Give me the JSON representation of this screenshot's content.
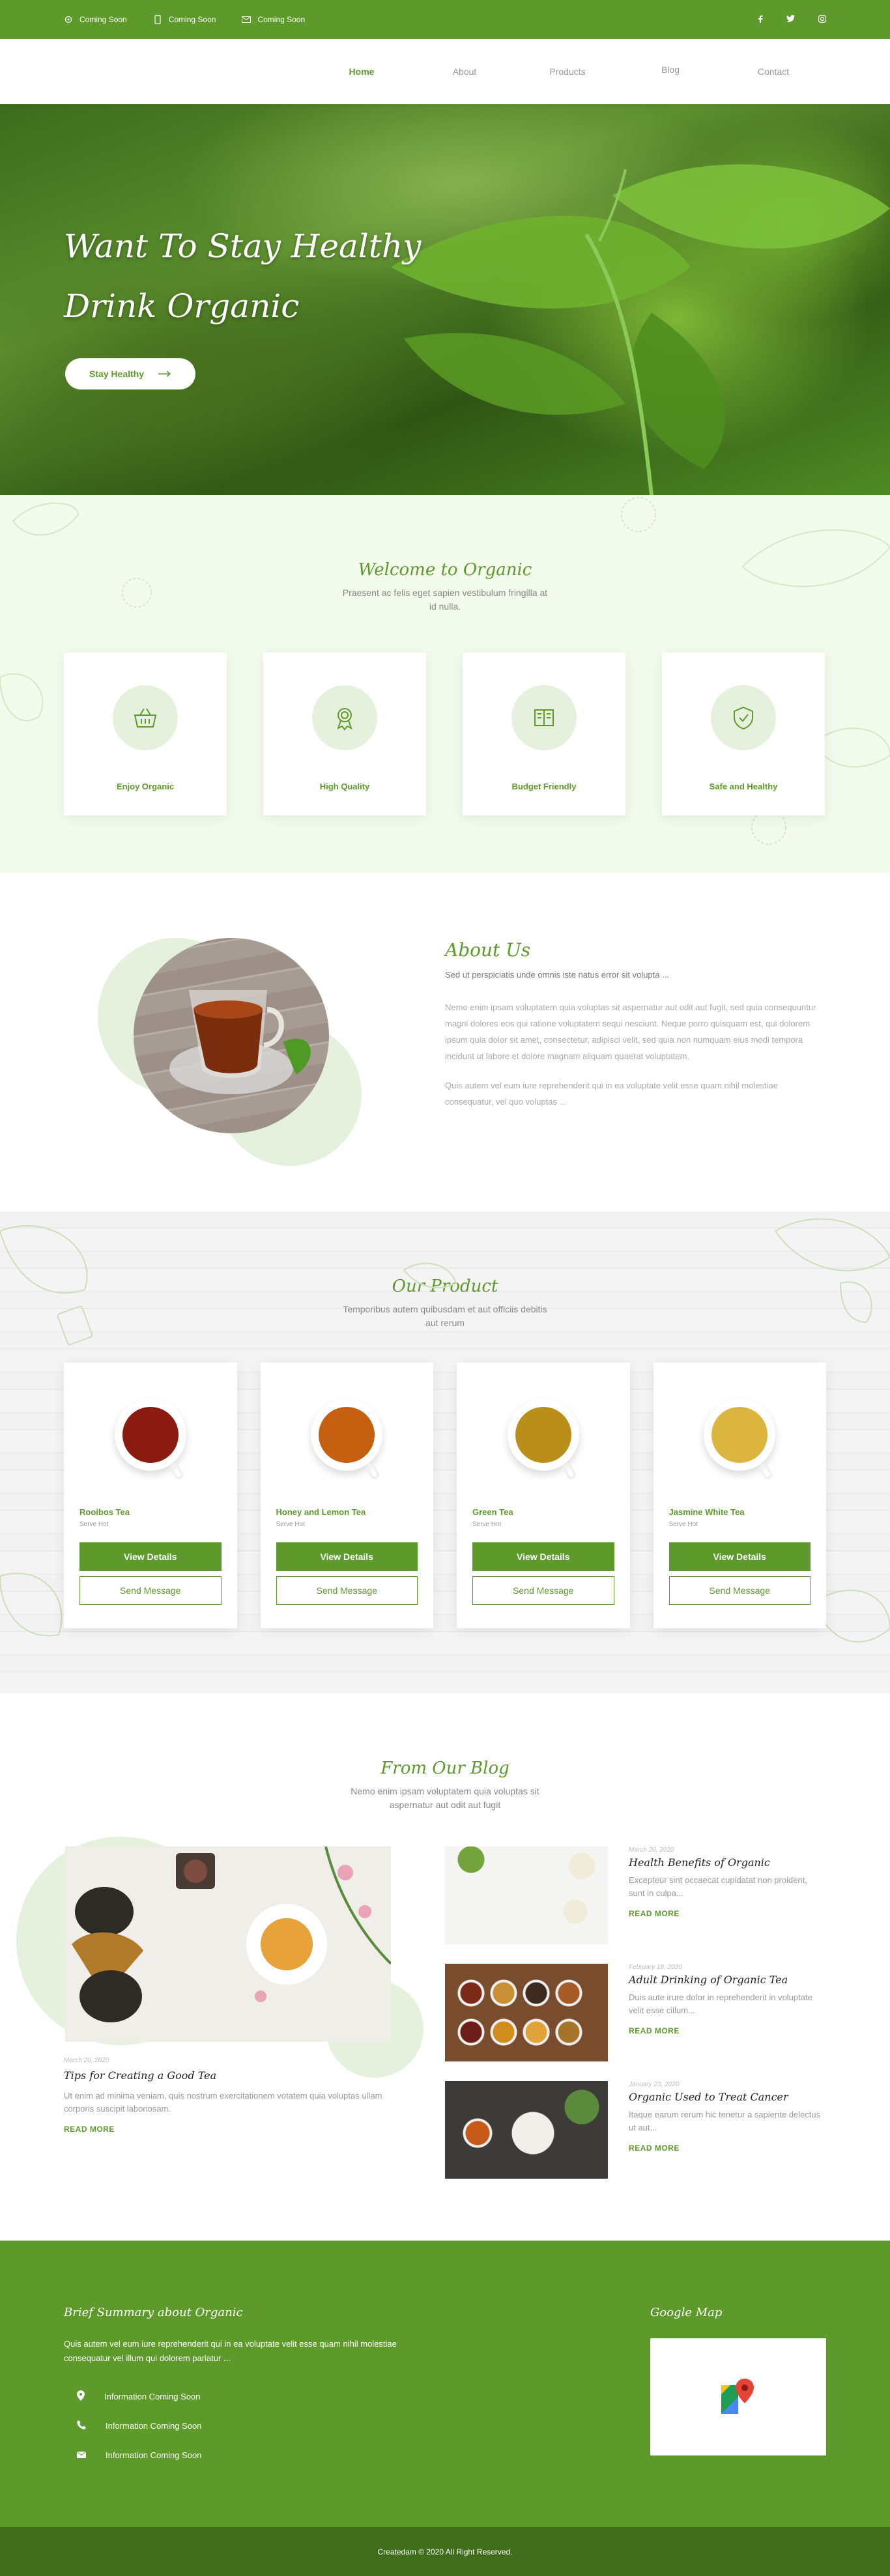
{
  "topbar": {
    "contacts": [
      {
        "icon": "location-icon",
        "text": "Coming Soon"
      },
      {
        "icon": "phone-icon",
        "text": "Coming Soon"
      },
      {
        "icon": "mail-icon",
        "text": "Coming Soon"
      }
    ],
    "socials": [
      "facebook-icon",
      "twitter-icon",
      "instagram-icon"
    ]
  },
  "nav": {
    "items": [
      "Home",
      "About",
      "Products",
      "Blog",
      "Contact"
    ],
    "active": "Home"
  },
  "hero": {
    "title_line1": "Want To Stay Healthy",
    "title_line2": "Drink Organic",
    "button_label": "Stay Healthy"
  },
  "welcome": {
    "title": "Welcome to Organic",
    "subtitle": "Praesent ac felis eget sapien vestibulum fringilla at id nulla.",
    "features": [
      {
        "icon": "basket-icon",
        "label": "Enjoy Organic"
      },
      {
        "icon": "award-badge-icon",
        "label": "High Quality"
      },
      {
        "icon": "money-icon",
        "label": "Budget Friendly"
      },
      {
        "icon": "shield-check-icon",
        "label": "Safe and Healthy"
      }
    ]
  },
  "about": {
    "title": "About Us",
    "lead": "Sed ut perspiciatis unde omnis iste natus error sit volupta ...",
    "paragraph1": "Nemo enim ipsam voluptatem quia voluptas sit aspernatur aut odit aut fugit, sed quia consequuntur magni dolores eos qui ratione voluptatem sequi nesciunt. Neque porro quisquam est, qui dolorem ipsum quia dolor sit amet, consectetur, adipisci velit, sed quia non numquam eius modi tempora incidunt ut labore et dolore magnam aliquam quaerat voluptatem.",
    "paragraph2": "Quis autem vel eum iure reprehenderit qui in ea voluptate velit esse quam nihil molestiae consequatur, vel quo voluptas ..."
  },
  "products": {
    "title": "Our Product",
    "subtitle": "Temporibus autem quibusdam et aut officiis debitis aut rerum",
    "items": [
      {
        "name": "Rooibos Tea",
        "sub": "Serve Hot",
        "color": "#8b1a10"
      },
      {
        "name": "Honey and Lemon Tea",
        "sub": "Serve Hot",
        "color": "#c4600f"
      },
      {
        "name": "Green Tea",
        "sub": "Serve Hot",
        "color": "#b98f1a"
      },
      {
        "name": "Jasmine White Tea",
        "sub": "Serve Hot",
        "color": "#dbb53e"
      }
    ],
    "details_label": "View Details",
    "message_label": "Send Message"
  },
  "blog": {
    "title": "From Our Blog",
    "subtitle": "Nemo enim ipsam voluptatem quia voluptas sit aspernatur aut odit aut fugit",
    "main": {
      "date": "March 20, 2020",
      "title": "Tips for Creating a Good Tea",
      "excerpt": "Ut enim ad minima veniam, quis nostrum exercitationem votatem quia voluptas ullam corporis suscipit laboriosam.",
      "readmore": "READ MORE"
    },
    "side": [
      {
        "date": "March 20, 2020",
        "title": "Health Benefits of Organic",
        "excerpt": "Excepteur sint occaecat cupidatat non proident, sunt in culpa...",
        "readmore": "READ MORE"
      },
      {
        "date": "February 18, 2020",
        "title": "Adult Drinking of Organic Tea",
        "excerpt": "Duis aute irure dolor in reprehenderit in voluptate velit esse cillum...",
        "readmore": "READ MORE"
      },
      {
        "date": "January 23, 2020",
        "title": "Organic Used to Treat Cancer",
        "excerpt": "Itaque earum rerum hic tenetur a sapiente delectus ut aut...",
        "readmore": "READ MORE"
      }
    ]
  },
  "footer": {
    "title": "Brief Summary about Organic",
    "summary": "Quis autem vel eum iure reprehenderit qui in ea voluptate velit esse quam nihil molestiae consequatur vel illum qui dolorem pariatur ...",
    "info": [
      {
        "icon": "location-icon",
        "text": "Information Coming Soon"
      },
      {
        "icon": "phone-icon",
        "text": "Information Coming Soon"
      },
      {
        "icon": "mail-icon",
        "text": "Information Coming Soon"
      }
    ],
    "map_title": "Google Map",
    "copyright": "Createdam © 2020 All Right Reserved."
  },
  "colors": {
    "brand": "#5e9a2b",
    "brand_dark": "#3f6d1c",
    "tint": "#e6f1dd"
  }
}
